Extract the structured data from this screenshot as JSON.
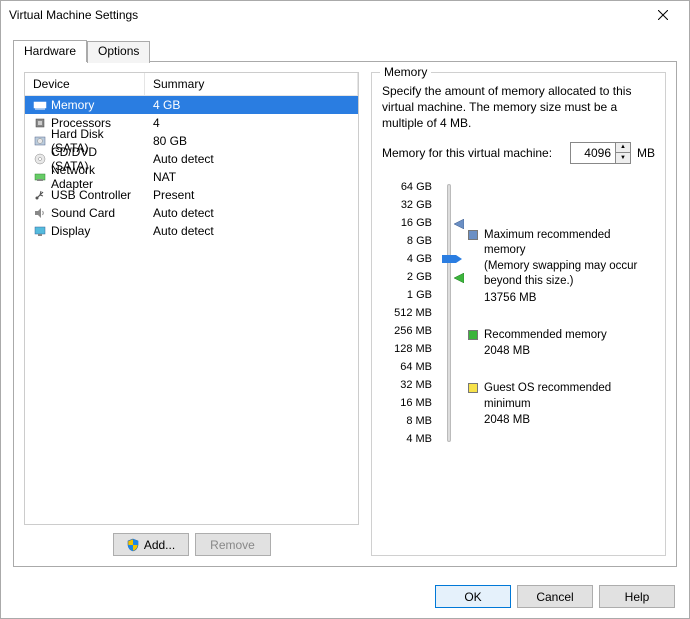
{
  "window": {
    "title": "Virtual Machine Settings"
  },
  "tabs": {
    "hardware": "Hardware",
    "options": "Options"
  },
  "table": {
    "headers": {
      "device": "Device",
      "summary": "Summary"
    },
    "rows": [
      {
        "icon": "memory-icon",
        "device": "Memory",
        "summary": "4 GB",
        "selected": true
      },
      {
        "icon": "cpu-icon",
        "device": "Processors",
        "summary": "4"
      },
      {
        "icon": "disk-icon",
        "device": "Hard Disk (SATA)",
        "summary": "80 GB"
      },
      {
        "icon": "cd-icon",
        "device": "CD/DVD (SATA)",
        "summary": "Auto detect"
      },
      {
        "icon": "nic-icon",
        "device": "Network Adapter",
        "summary": "NAT"
      },
      {
        "icon": "usb-icon",
        "device": "USB Controller",
        "summary": "Present"
      },
      {
        "icon": "sound-icon",
        "device": "Sound Card",
        "summary": "Auto detect"
      },
      {
        "icon": "display-icon",
        "device": "Display",
        "summary": "Auto detect"
      }
    ]
  },
  "left_buttons": {
    "add": "Add...",
    "remove": "Remove"
  },
  "memory": {
    "group_title": "Memory",
    "description": "Specify the amount of memory allocated to this virtual machine. The memory size must be a multiple of 4 MB.",
    "input_label": "Memory for this virtual machine:",
    "value": "4096",
    "unit": "MB",
    "ticks": [
      "64 GB",
      "32 GB",
      "16 GB",
      "8 GB",
      "4 GB",
      "2 GB",
      "1 GB",
      "512 MB",
      "256 MB",
      "128 MB",
      "64 MB",
      "32 MB",
      "16 MB",
      "8 MB",
      "4 MB"
    ],
    "legend": {
      "max": {
        "label": "Maximum recommended memory",
        "note": "(Memory swapping may occur beyond this size.)",
        "value": "13756 MB",
        "color": "#6b8fc4"
      },
      "rec": {
        "label": "Recommended memory",
        "value": "2048 MB",
        "color": "#3cb43c"
      },
      "min": {
        "label": "Guest OS recommended minimum",
        "value": "2048 MB",
        "color": "#f7e24a"
      }
    }
  },
  "footer": {
    "ok": "OK",
    "cancel": "Cancel",
    "help": "Help"
  }
}
